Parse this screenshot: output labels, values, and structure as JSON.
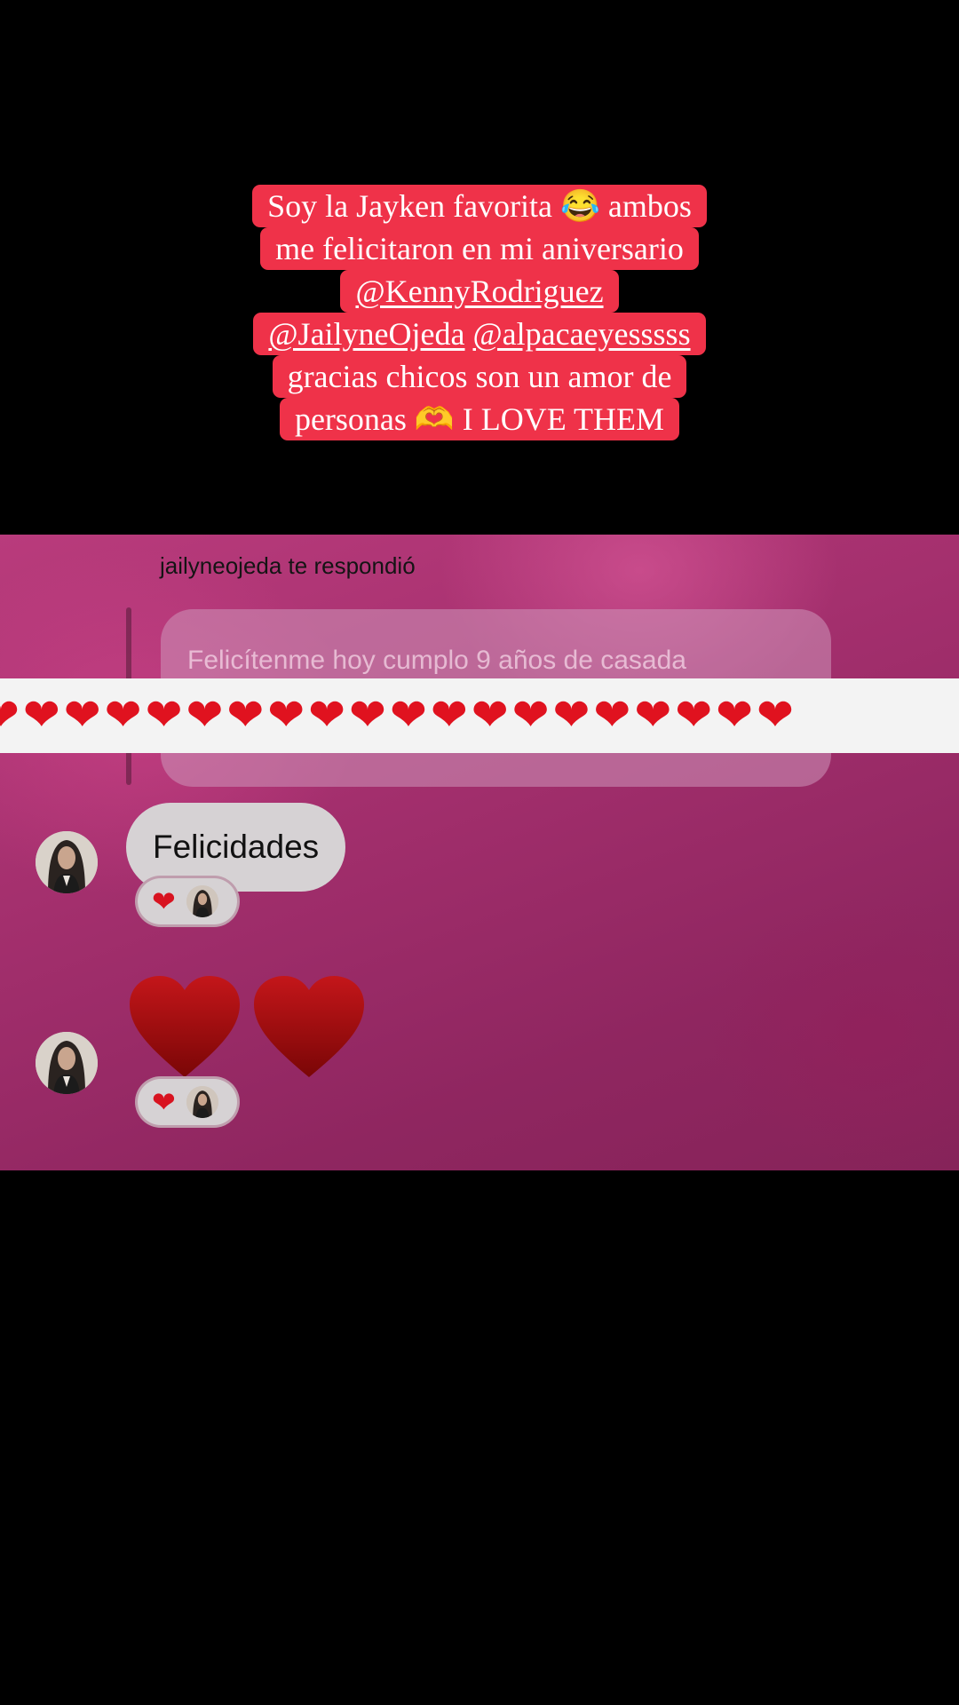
{
  "caption": {
    "line1": "Soy la Jayken favorita 😂 ambos",
    "line2": "me felicitaron en mi aniversario",
    "mention1": "@KennyRodriguez",
    "mention2": "@JailyneOjeda",
    "mention3": "@alpacaeyesssss",
    "line5": "gracias chicos son un amor de",
    "line6": "personas 🫶 I LOVE THEM"
  },
  "dm": {
    "replied_label": "jailyneojeda te respondió",
    "quoted_message": "Felicítenme hoy cumplo 9 años de casada",
    "hearts_strip": "❤❤❤❤❤❤❤❤❤❤❤❤❤❤❤❤❤❤❤❤",
    "message_text": "Felicidades",
    "reaction_heart": "❤"
  },
  "colors": {
    "caption_bg": "#ef3249",
    "heart_red": "#e0121f",
    "big_heart": "#9e0c0c"
  }
}
